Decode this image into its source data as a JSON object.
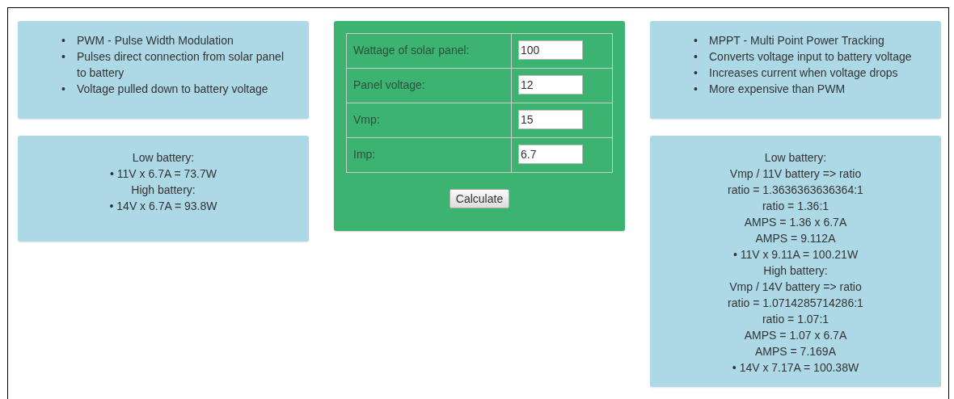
{
  "left": {
    "marker": "•",
    "bullets": [
      "PWM - Pulse Width Modulation",
      "Pulses direct connection from solar panel to battery",
      "Voltage pulled down to battery voltage"
    ],
    "lines": [
      "Low battery:",
      "• 11V x 6.7A = 73.7W",
      "High battery:",
      "• 14V x 6.7A = 93.8W"
    ]
  },
  "calculator": {
    "fields": [
      {
        "label": "Wattage of solar panel:",
        "value": "100"
      },
      {
        "label": "Panel voltage:",
        "value": "12"
      },
      {
        "label": "Vmp:",
        "value": "15"
      },
      {
        "label": "Imp:",
        "value": "6.7"
      }
    ],
    "button": "Calculate"
  },
  "right": {
    "marker": "•",
    "bullets": [
      "MPPT - Multi Point Power Tracking",
      "Converts voltage input to battery voltage",
      "Increases current when voltage drops",
      "More expensive than PWM"
    ],
    "lines": [
      "Low battery:",
      "Vmp / 11V battery => ratio",
      "ratio = 1.3636363636364:1",
      "ratio = 1.36:1",
      "AMPS = 1.36 x 6.7A",
      "AMPS = 9.112A",
      "• 11V x 9.11A = 100.21W",
      "High battery:",
      "Vmp / 14V battery => ratio",
      "ratio = 1.0714285714286:1",
      "ratio = 1.07:1",
      "AMPS = 1.07 x 6.7A",
      "AMPS = 7.169A",
      "• 14V x 7.17A = 100.38W"
    ]
  }
}
